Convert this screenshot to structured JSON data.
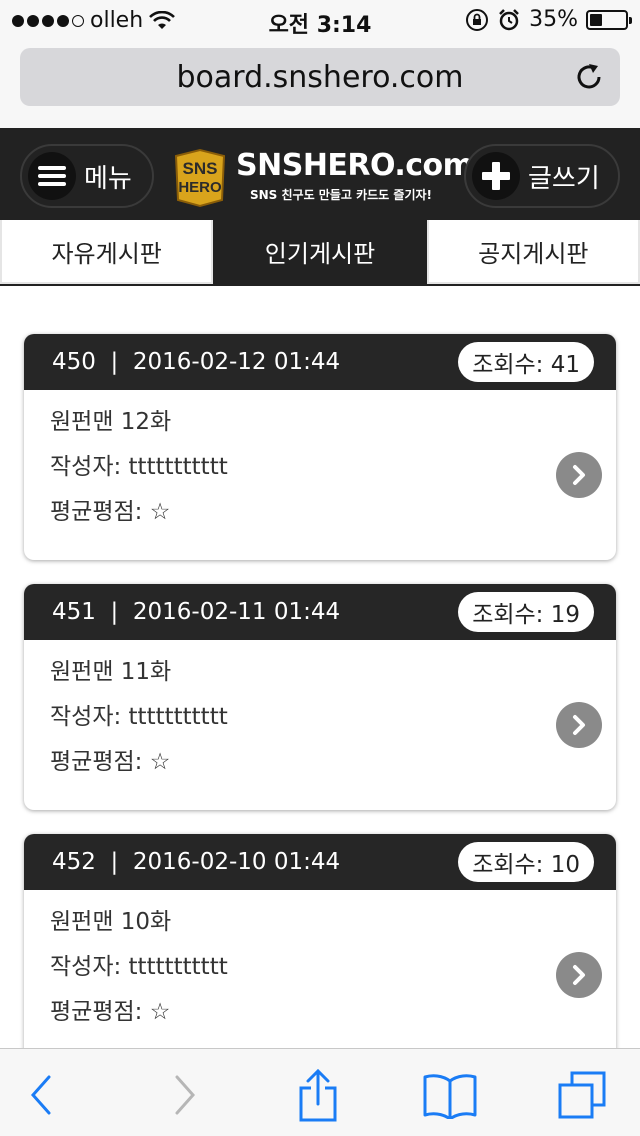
{
  "status_bar": {
    "carrier": "olleh",
    "time": "오전 3:14",
    "battery": "35%",
    "battery_level": 0.35,
    "signal_dots_filled": 4
  },
  "browser": {
    "url": "board.snshero.com"
  },
  "header": {
    "menu_label": "메뉴",
    "logo_badge_top": "SNS",
    "logo_badge_bottom": "HERO",
    "logo_title": "SNSHERO.com",
    "logo_subtitle": "SNS 친구도 만들고 카드도 즐기자!",
    "write_label": "글쓰기"
  },
  "tabs": [
    {
      "label": "자유게시판",
      "active": false
    },
    {
      "label": "인기게시판",
      "active": true
    },
    {
      "label": "공지게시판",
      "active": false
    }
  ],
  "posts": [
    {
      "header": "450  |  2016-02-12 01:44",
      "views": "조회수: 41",
      "title": "원펀맨 12화",
      "author": "작성자: ttttttttttt",
      "rating": "평균평점: ☆"
    },
    {
      "header": "451  |  2016-02-11 01:44",
      "views": "조회수: 19",
      "title": "원펀맨 11화",
      "author": "작성자: ttttttttttt",
      "rating": "평균평점: ☆"
    },
    {
      "header": "452  |  2016-02-10 01:44",
      "views": "조회수: 10",
      "title": "원펀맨 10화",
      "author": "작성자: ttttttttttt",
      "rating": "평균평점: ☆"
    }
  ],
  "colors": {
    "header_bg": "#222222",
    "ios_blue": "#1a7cf5",
    "arrow_gray": "#8a8a8a"
  },
  "icons": [
    "wifi-icon",
    "lock-rotation-icon",
    "alarm-icon",
    "battery-icon",
    "reload-icon",
    "hamburger-icon",
    "plus-icon",
    "chevron-right-icon",
    "back-icon",
    "forward-icon",
    "share-icon",
    "bookmarks-icon",
    "tabs-icon"
  ]
}
